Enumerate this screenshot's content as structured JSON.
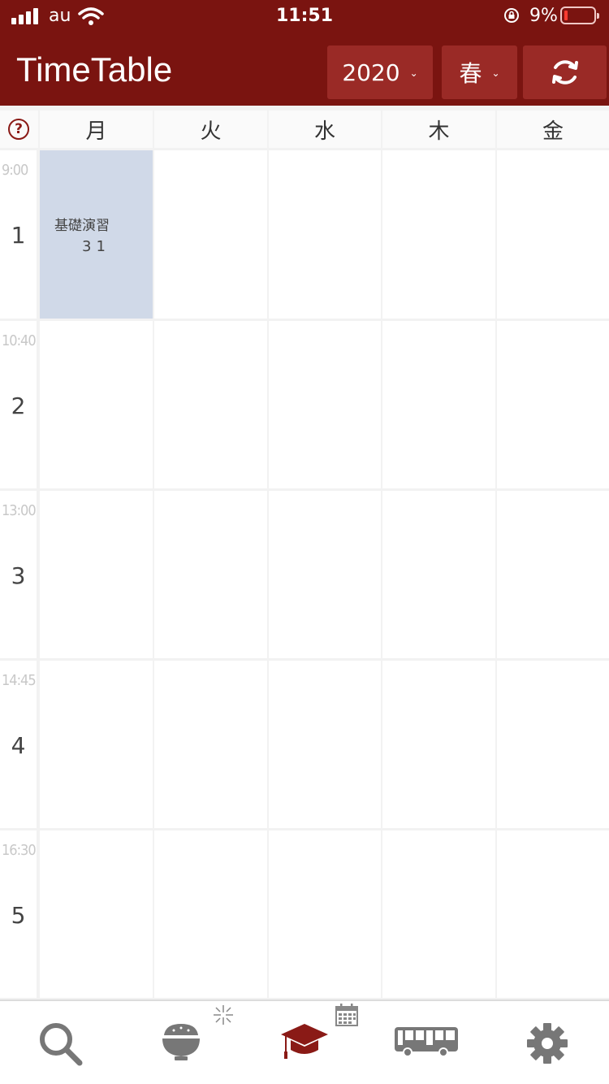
{
  "status": {
    "carrier": "au",
    "time": "11:51",
    "battery": "9%"
  },
  "header": {
    "title": "TimeTable",
    "year": "2020",
    "term": "春"
  },
  "days": [
    "月",
    "火",
    "水",
    "木",
    "金"
  ],
  "periods": [
    {
      "number": "1",
      "start": "9:00"
    },
    {
      "number": "2",
      "start": "10:40"
    },
    {
      "number": "3",
      "start": "13:00"
    },
    {
      "number": "4",
      "start": "14:45"
    },
    {
      "number": "5",
      "start": "16:30"
    }
  ],
  "courses": [
    {
      "day": "月",
      "period": "1",
      "name": "基礎演習",
      "room": "31"
    }
  ],
  "tabs": [
    {
      "icon": "search-icon"
    },
    {
      "icon": "rice-bowl-icon"
    },
    {
      "icon": "graduation-cap-icon",
      "active": true
    },
    {
      "icon": "bus-icon"
    },
    {
      "icon": "gear-icon"
    }
  ],
  "colors": {
    "header": "#7a1410",
    "button": "#9a2a26",
    "course_cell": "#d0d9e8",
    "active_tab": "#8a1a16",
    "inactive_tab": "#777777"
  }
}
